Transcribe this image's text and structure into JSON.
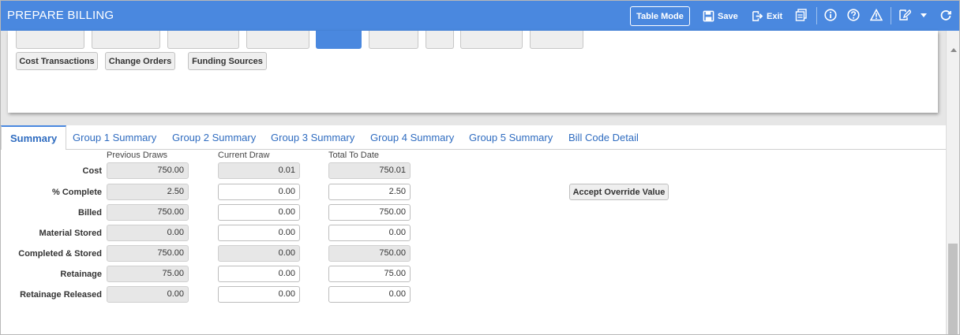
{
  "header": {
    "title": "PREPARE BILLING",
    "table_mode_label": "Table Mode",
    "save_label": "Save",
    "exit_label": "Exit",
    "icons": [
      "save-icon",
      "exit-icon",
      "print-icon",
      "info-icon",
      "help-icon",
      "warning-icon",
      "edit-icon",
      "chevron-down-icon",
      "refresh-icon"
    ]
  },
  "upper_buttons": [
    {
      "label": "Cost Transactions"
    },
    {
      "label": "Change Orders"
    },
    {
      "label": "Funding Sources"
    }
  ],
  "tabs": [
    {
      "label": "Summary",
      "active": true
    },
    {
      "label": "Group 1 Summary"
    },
    {
      "label": "Group 2 Summary"
    },
    {
      "label": "Group 3 Summary"
    },
    {
      "label": "Group 4 Summary"
    },
    {
      "label": "Group 5 Summary"
    },
    {
      "label": "Bill Code Detail"
    }
  ],
  "summary": {
    "columns": [
      "Previous Draws",
      "Current Draw",
      "Total To Date"
    ],
    "rows": [
      {
        "label": "Cost",
        "previous": "750.00",
        "current": "0.01",
        "total": "750.01"
      },
      {
        "label": "% Complete",
        "previous": "2.50",
        "current": "0.00",
        "total": "2.50"
      },
      {
        "label": "Billed",
        "previous": "750.00",
        "current": "0.00",
        "total": "750.00"
      },
      {
        "label": "Material Stored",
        "previous": "0.00",
        "current": "0.00",
        "total": "0.00"
      },
      {
        "label": "Completed & Stored",
        "previous": "750.00",
        "current": "0.00",
        "total": "750.00"
      },
      {
        "label": "Retainage",
        "previous": "75.00",
        "current": "0.00",
        "total": "75.00"
      },
      {
        "label": "Retainage Released",
        "previous": "0.00",
        "current": "0.00",
        "total": "0.00"
      }
    ],
    "accept_override_label": "Accept Override Value"
  },
  "colors": {
    "header_bg": "#4a88df",
    "tab_text": "#2f6cc0",
    "readonly_bg": "#e7e7e7"
  }
}
